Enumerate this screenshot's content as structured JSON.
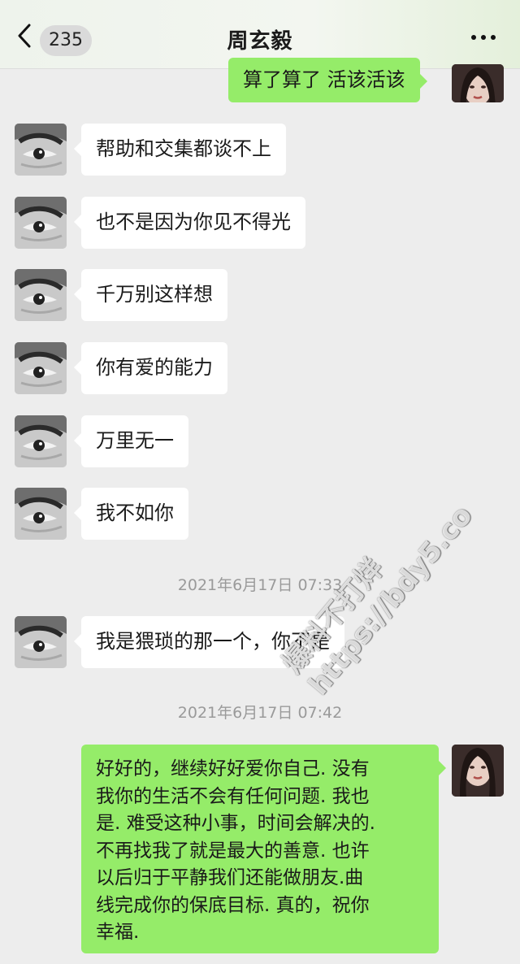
{
  "header": {
    "back_icon": "chevron-left-icon",
    "unread_count": "235",
    "title": "周玄毅",
    "more_icon": "ellipsis-icon"
  },
  "messages": [
    {
      "side": "out",
      "text": "算了算了 活该活该"
    },
    {
      "side": "in",
      "text": "帮助和交集都谈不上"
    },
    {
      "side": "in",
      "text": "也不是因为你见不得光"
    },
    {
      "side": "in",
      "text": "千万别这样想"
    },
    {
      "side": "in",
      "text": "你有爱的能力"
    },
    {
      "side": "in",
      "text": "万里无一"
    },
    {
      "side": "in",
      "text": "我不如你"
    },
    {
      "timestamp": "2021年6月17日 07:33"
    },
    {
      "side": "in",
      "text": "我是猥琐的那一个，你不是"
    },
    {
      "timestamp": "2021年6月17日 07:42"
    },
    {
      "side": "out",
      "lines": [
        "好好的，继续好好爱你自己. 没有",
        "我你的生活不会有任何问题. 我也",
        "是. 难受这种小事，时间会解决的.",
        "不再找我了就是最大的善意. 也许",
        "以后归于平静我们还能做朋友.曲",
        "线完成你的保底目标. 真的，祝你",
        "幸福."
      ]
    }
  ],
  "watermark": {
    "line1": "爆料不打烊",
    "line2": "https://bdy5.co"
  },
  "colors": {
    "background": "#ededed",
    "bubble_out": "#95ec69",
    "bubble_in": "#ffffff",
    "timestamp_text": "#9a9a9a"
  }
}
